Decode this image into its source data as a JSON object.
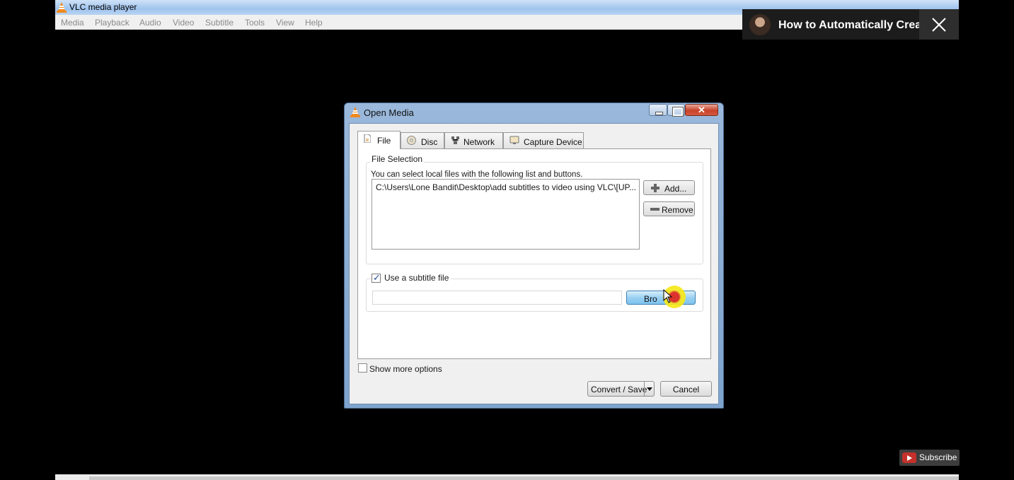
{
  "app": {
    "title": "VLC media player",
    "menu": [
      "Media",
      "Playback",
      "Audio",
      "Video",
      "Subtitle",
      "Tools",
      "View",
      "Help"
    ]
  },
  "youtube": {
    "video_title": "How to Automatically Crea...",
    "subscribe_label": "Subscribe"
  },
  "dialog": {
    "title": "Open Media",
    "close_symbol": "✕",
    "tabs": [
      {
        "label": "File",
        "icon": "file-icon",
        "selected": true
      },
      {
        "label": "Disc",
        "icon": "disc-icon",
        "selected": false
      },
      {
        "label": "Network",
        "icon": "network-icon",
        "selected": false
      },
      {
        "label": "Capture Device",
        "icon": "capture-device-icon",
        "selected": false
      }
    ],
    "file_selection": {
      "group_title": "File Selection",
      "description": "You can select local files with the following list and buttons.",
      "files": [
        "C:\\Users\\Lone Bandit\\Desktop\\add subtitles to video using VLC\\[UP..."
      ],
      "add_label": "Add...",
      "remove_label": "Remove"
    },
    "subtitle": {
      "checkbox_label": "Use a subtitle file",
      "checked": true,
      "path_value": "",
      "browse_label": "Bro"
    },
    "show_more_options": {
      "label": "Show more options",
      "checked": false
    },
    "convert_label": "Convert / Save",
    "cancel_label": "Cancel"
  },
  "colors": {
    "titlebar_blue": "#9fc3ec",
    "close_red": "#c8432b",
    "browse_blue": "#9ad1f3",
    "highlight_yellow": "#f6e81a",
    "highlight_red": "#e0241c"
  }
}
